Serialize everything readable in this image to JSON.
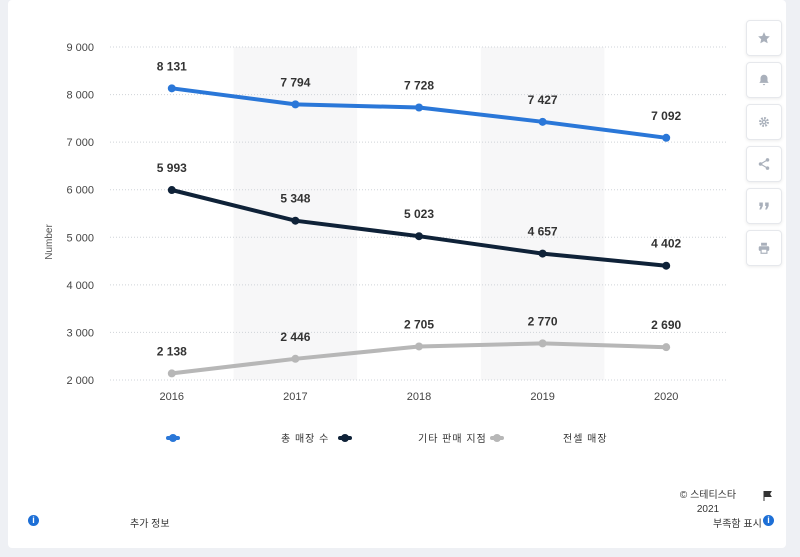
{
  "chart_data": {
    "type": "line",
    "x": [
      "2016",
      "2017",
      "2018",
      "2019",
      "2020"
    ],
    "ylabel": "Number",
    "ylim": [
      2000,
      9000
    ],
    "yticks": [
      2000,
      3000,
      4000,
      5000,
      6000,
      7000,
      8000,
      9000
    ],
    "ytick_labels": [
      "2 000",
      "3 000",
      "4 000",
      "5 000",
      "6 000",
      "7 000",
      "8 000",
      "9 000"
    ],
    "grid": "horizontal-dotted",
    "series": [
      {
        "name": "총 매장 수",
        "color": "#2a77d8",
        "values": [
          8131,
          7794,
          7728,
          7427,
          7092
        ],
        "labels": [
          "8 131",
          "7 794",
          "7 728",
          "7 427",
          "7 092"
        ]
      },
      {
        "name": "기타 판매 지점",
        "color": "#0f2238",
        "values": [
          5993,
          5348,
          5023,
          4657,
          4402
        ],
        "labels": [
          "5 993",
          "5 348",
          "5 023",
          "4 657",
          "4 402"
        ]
      },
      {
        "name": "전셀 매장",
        "color": "#b7b7b7",
        "values": [
          2138,
          2446,
          2705,
          2770,
          2690
        ],
        "labels": [
          "2 138",
          "2 446",
          "2 705",
          "2 770",
          "2 690"
        ]
      }
    ]
  },
  "footer": {
    "copyright": "© 스테티스타 2021",
    "more_info": "추가 정보",
    "report": "부족함 표시"
  },
  "toolbar": {
    "icons": [
      "star-icon",
      "bell-icon",
      "gear-icon",
      "share-icon",
      "quote-icon",
      "print-icon"
    ]
  }
}
